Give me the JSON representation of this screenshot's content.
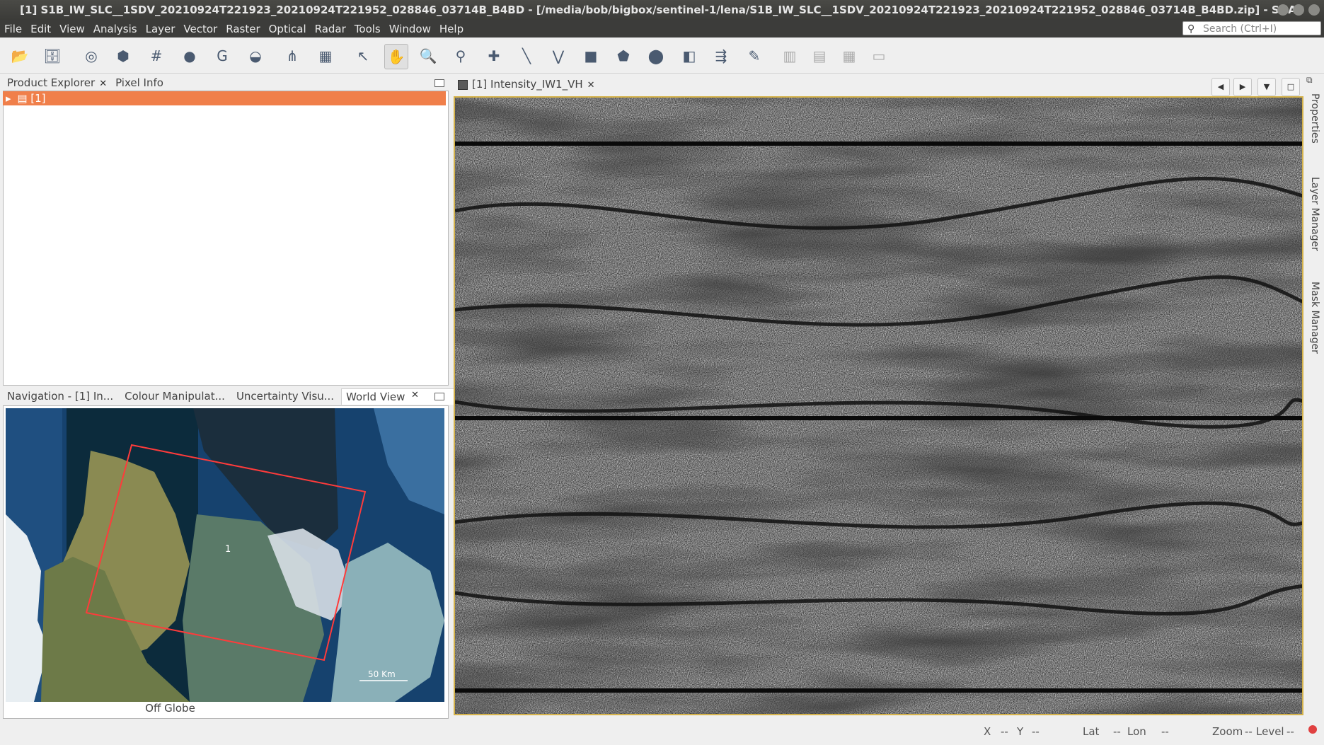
{
  "window": {
    "title": "[1] S1B_IW_SLC__1SDV_20210924T221923_20210924T221952_028846_03714B_B4BD - [/media/bob/bigbox/sentinel-1/lena/S1B_IW_SLC__1SDV_20210924T221923_20210924T221952_028846_03714B_B4BD.zip] - SNAP"
  },
  "menu": [
    "File",
    "Edit",
    "View",
    "Analysis",
    "Layer",
    "Vector",
    "Raster",
    "Optical",
    "Radar",
    "Tools",
    "Window",
    "Help"
  ],
  "search": {
    "placeholder": "Search (Ctrl+I)"
  },
  "toolbar_icons": [
    "open-product-icon",
    "save-product-icon",
    "session-icon",
    "export-icon",
    "graticule-icon",
    "pin-placing-icon",
    "gcp-placing-icon",
    "layer-icon",
    "graph-builder-icon",
    "batch-processing-icon",
    "select-tool-icon",
    "pan-tool-icon",
    "zoom-tool-icon",
    "pin-tool-icon",
    "gcp-tool-icon",
    "line-tool-icon",
    "polyline-tool-icon",
    "rectangle-tool-icon",
    "polygon-tool-icon",
    "ellipse-tool-icon",
    "range-finder-icon",
    "magic-wand-icon",
    "draw-icon",
    "tile-vertical-icon",
    "tile-horizontal-icon",
    "tile-grid-icon",
    "tile-single-icon"
  ],
  "top_panel": {
    "tabs": [
      {
        "label": "Product Explorer",
        "closable": true
      },
      {
        "label": "Pixel Info",
        "closable": false
      }
    ],
    "product": "[1] S1B_IW_SLC__1SDV_20210924T221923_20210924T221952_028846_03714B_B4BD"
  },
  "bottom_panel": {
    "tabs": [
      "Navigation - [1] In...",
      "Colour Manipulat...",
      "Uncertainty Visu...",
      "World View"
    ],
    "map": {
      "footprint_label": "1",
      "scale_label": "50 Km",
      "status": "Off Globe"
    }
  },
  "image_view": {
    "tab": "[1] Intensity_IW1_VH"
  },
  "right_sidebar": [
    "Properties",
    "Layer Manager",
    "Mask Manager"
  ],
  "statusbar": {
    "x_label": "X",
    "x_value": "--",
    "y_label": "Y",
    "y_value": "--",
    "lat_label": "Lat",
    "lat_value": "--",
    "lon_label": "Lon",
    "lon_value": "--",
    "zoom_label": "Zoom",
    "zoom_value": "--",
    "level_label": "Level",
    "level_value": "--"
  },
  "colors": {
    "selection": "#f07f4a",
    "image_border": "#d4b24a",
    "footprint": "#ff3b3b"
  }
}
